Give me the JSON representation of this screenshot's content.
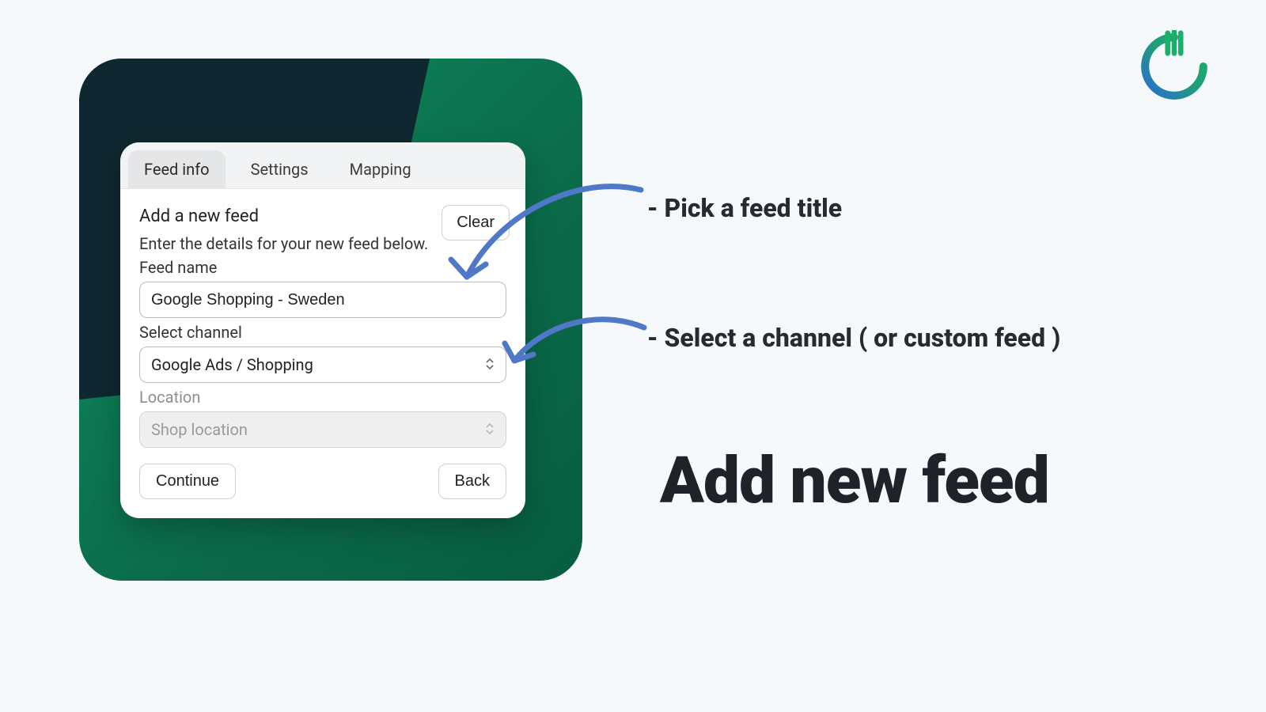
{
  "tabs": {
    "feed_info": "Feed info",
    "settings": "Settings",
    "mapping": "Mapping"
  },
  "section": {
    "title": "Add a new feed",
    "subtitle": "Enter the details for your new feed below."
  },
  "clear_label": "Clear",
  "feed_name": {
    "label": "Feed name",
    "value": "Google Shopping - Sweden"
  },
  "channel": {
    "label": "Select channel",
    "value": "Google Ads / Shopping"
  },
  "location": {
    "label": "Location",
    "placeholder": "Shop location"
  },
  "actions": {
    "continue": "Continue",
    "back": "Back"
  },
  "annot": {
    "title_hint": "- Pick a feed title",
    "channel_hint": "- Select a channel ( or custom feed )",
    "big": "Add new feed"
  }
}
